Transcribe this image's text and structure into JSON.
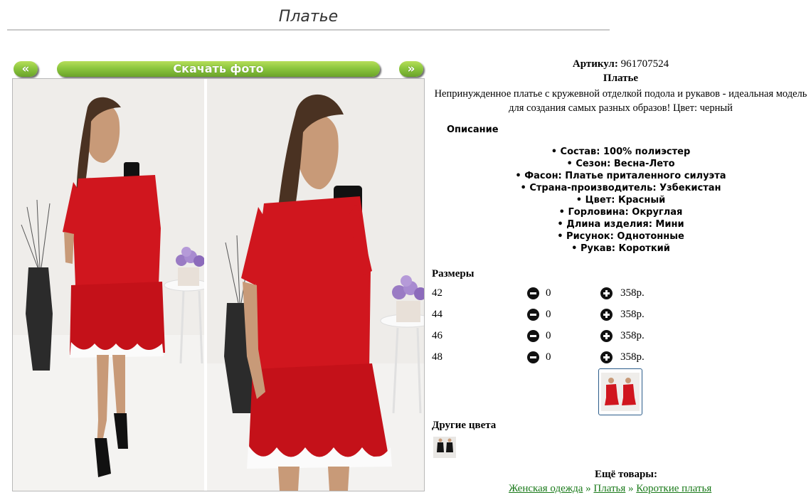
{
  "page": {
    "title": "Платье"
  },
  "gallery": {
    "prev_label": "«",
    "next_label": "»",
    "download_label": "Скачать фото"
  },
  "product": {
    "article_label": "Артикул:",
    "article_value": "961707524",
    "name": "Платье",
    "description": "Непринужденное платье с кружевной отделкой подола и рукавов - идеальная модель для создания самых разных образов! Цвет: черный",
    "desc_heading": "Описание",
    "properties": [
      "Состав: 100% полиэстер",
      "Сезон: Весна-Лето",
      "Фасон: Платье приталенного силуэта",
      "Страна-производитель: Узбекистан",
      "Цвет: Красный",
      "Горловина: Округлая",
      "Длина изделия: Мини",
      "Рисунок: Однотонные",
      "Рукав: Короткий"
    ]
  },
  "sizes": {
    "heading": "Размеры",
    "rows": [
      {
        "size": "42",
        "qty": "0",
        "price": "358р."
      },
      {
        "size": "44",
        "qty": "0",
        "price": "358р."
      },
      {
        "size": "46",
        "qty": "0",
        "price": "358р."
      },
      {
        "size": "48",
        "qty": "0",
        "price": "358р."
      }
    ]
  },
  "other_colors": {
    "heading": "Другие цвета"
  },
  "more": {
    "heading": "Ещё товары:",
    "breadcrumbs": [
      "Женская одежда",
      "Платья",
      "Короткие платья"
    ],
    "separator": "»"
  },
  "colors": {
    "button_green": "#8cc63e",
    "dress_red": "#d0161e",
    "link_green": "#1a7a1a",
    "thumb_border": "#2b5c8a"
  }
}
